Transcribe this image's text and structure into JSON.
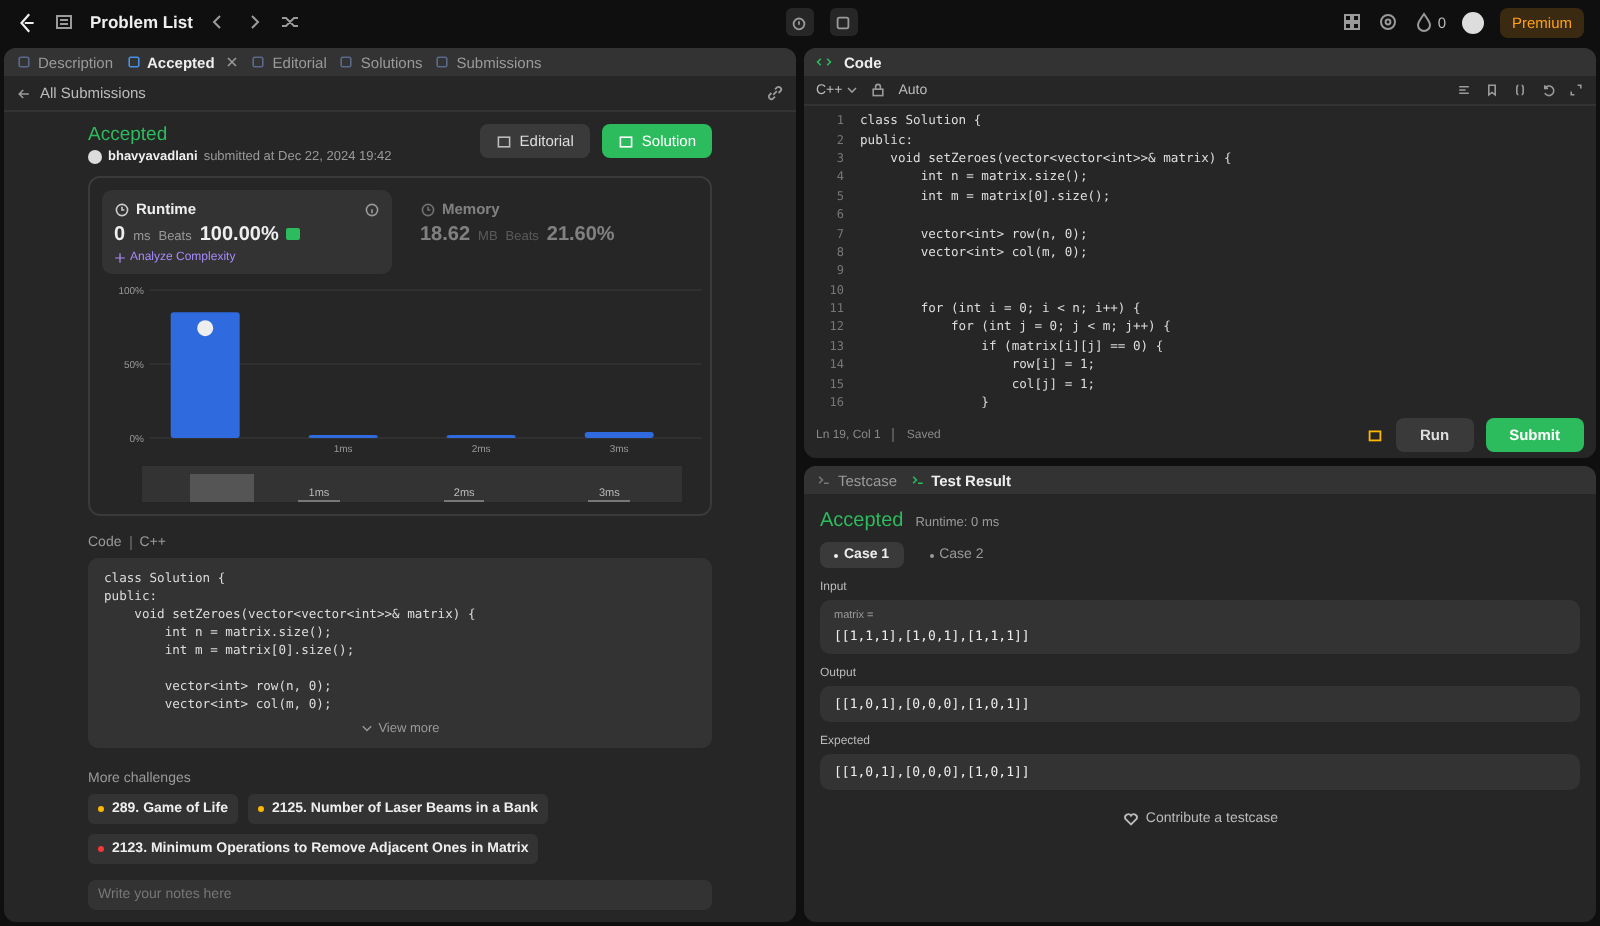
{
  "topbar": {
    "title": "Problem List",
    "streak": "0",
    "premium": "Premium"
  },
  "left_tabs": [
    {
      "label": "Description",
      "selected": false,
      "closable": false
    },
    {
      "label": "Accepted",
      "selected": true,
      "closable": true
    },
    {
      "label": "Editorial",
      "selected": false,
      "closable": false
    },
    {
      "label": "Solutions",
      "selected": false,
      "closable": false
    },
    {
      "label": "Submissions",
      "selected": false,
      "closable": false
    }
  ],
  "back_link": "All Submissions",
  "submission": {
    "status": "Accepted",
    "user": "bhavyavadlani",
    "submitted": "submitted at Dec 22, 2024 19:42",
    "buttons": [
      {
        "label": "Editorial",
        "kind": "secondary"
      },
      {
        "label": "Solution",
        "kind": "primary"
      }
    ]
  },
  "stats": [
    {
      "label": "Runtime",
      "value": "0",
      "unit": "ms",
      "beats_label": "Beats",
      "beats": "100.00%",
      "selected": true,
      "link": "Analyze Complexity"
    },
    {
      "label": "Memory",
      "value": "18.62",
      "unit": "MB",
      "beats_label": "Beats",
      "beats": "21.60%",
      "selected": false
    }
  ],
  "chart_data": {
    "type": "bar",
    "categories": [
      null,
      "1ms",
      "2ms",
      "3ms"
    ],
    "values": [
      85,
      2,
      2,
      4
    ],
    "ylim": [
      0,
      100
    ],
    "yticks": [
      {
        "value": 0,
        "label": "0%"
      },
      {
        "value": 50,
        "label": "50%"
      },
      {
        "value": 100,
        "label": "100%"
      }
    ]
  },
  "brush_labels": [
    "1ms",
    "2ms",
    "3ms"
  ],
  "code_section": {
    "label": "Code",
    "language": "C++",
    "view_more": "View more",
    "lines": [
      {
        "kind": "code",
        "text": "class Solution {"
      },
      {
        "kind": "code",
        "text": "public:"
      },
      {
        "kind": "code",
        "text": "    void setZeroes(vector<vector<int>>& matrix) {"
      },
      {
        "kind": "code",
        "text": "        int n = matrix.size();"
      },
      {
        "kind": "code",
        "text": "        int m = matrix[0].size();"
      },
      {
        "kind": "blank"
      },
      {
        "kind": "code",
        "text": "        vector<int> row(n, 0);"
      },
      {
        "kind": "code",
        "text": "        vector<int> col(m, 0);"
      }
    ]
  },
  "more_challenges": {
    "title": "More challenges",
    "items": [
      {
        "label": "289. Game of Life",
        "color": "#ffb800"
      },
      {
        "label": "2125. Number of Laser Beams in a Bank",
        "color": "#ffb800"
      },
      {
        "label": "2123. Minimum Operations to Remove Adjacent Ones in Matrix",
        "color": "#f63737"
      }
    ]
  },
  "notes": {
    "placeholder": "Write your notes here"
  },
  "editor": {
    "title": "Code",
    "language": "C++",
    "mode": "Auto",
    "status": "Ln 19, Col 1",
    "saved": "Saved",
    "lines": [
      {
        "number": "1",
        "text": "class Solution {"
      },
      {
        "number": "2",
        "text": "public:"
      },
      {
        "number": "3",
        "text": "    void setZeroes(vector<vector<int>>& matrix) {"
      },
      {
        "number": "4",
        "text": "        int n = matrix.size();"
      },
      {
        "number": "5",
        "text": "        int m = matrix[0].size();"
      },
      {
        "number": "6"
      },
      {
        "number": "7",
        "text": "        vector<int> row(n, 0);"
      },
      {
        "number": "8",
        "text": "        vector<int> col(m, 0);"
      },
      {
        "number": "9"
      },
      {
        "number": "10"
      },
      {
        "number": "11",
        "text": "        for (int i = 0; i < n; i++) {"
      },
      {
        "number": "12",
        "text": "            for (int j = 0; j < m; j++) {"
      },
      {
        "number": "13",
        "text": "                if (matrix[i][j] == 0) {"
      },
      {
        "number": "14",
        "text": "                    row[i] = 1;"
      },
      {
        "number": "15",
        "text": "                    col[j] = 1;"
      },
      {
        "number": "16",
        "text": "                }"
      }
    ],
    "buttons": [
      {
        "label": "Run",
        "kind": "secondary"
      },
      {
        "label": "Submit",
        "kind": "primary"
      }
    ]
  },
  "result": {
    "tabs": [
      {
        "label": "Testcase",
        "selected": false
      },
      {
        "label": "Test Result",
        "selected": true
      }
    ],
    "status": "Accepted",
    "runtime": "Runtime: 0 ms",
    "cases": [
      {
        "label": "Case 1",
        "selected": true
      },
      {
        "label": "Case 2",
        "selected": false
      }
    ],
    "sections": [
      {
        "label": "Input",
        "variable": "matrix =",
        "value": "[[1,1,1],[1,0,1],[1,1,1]]"
      },
      {
        "label": "Output",
        "value": "[[1,0,1],[0,0,0],[1,0,1]]"
      },
      {
        "label": "Expected",
        "value": "[[1,0,1],[0,0,0],[1,0,1]]"
      }
    ],
    "contribute": "Contribute a testcase"
  }
}
